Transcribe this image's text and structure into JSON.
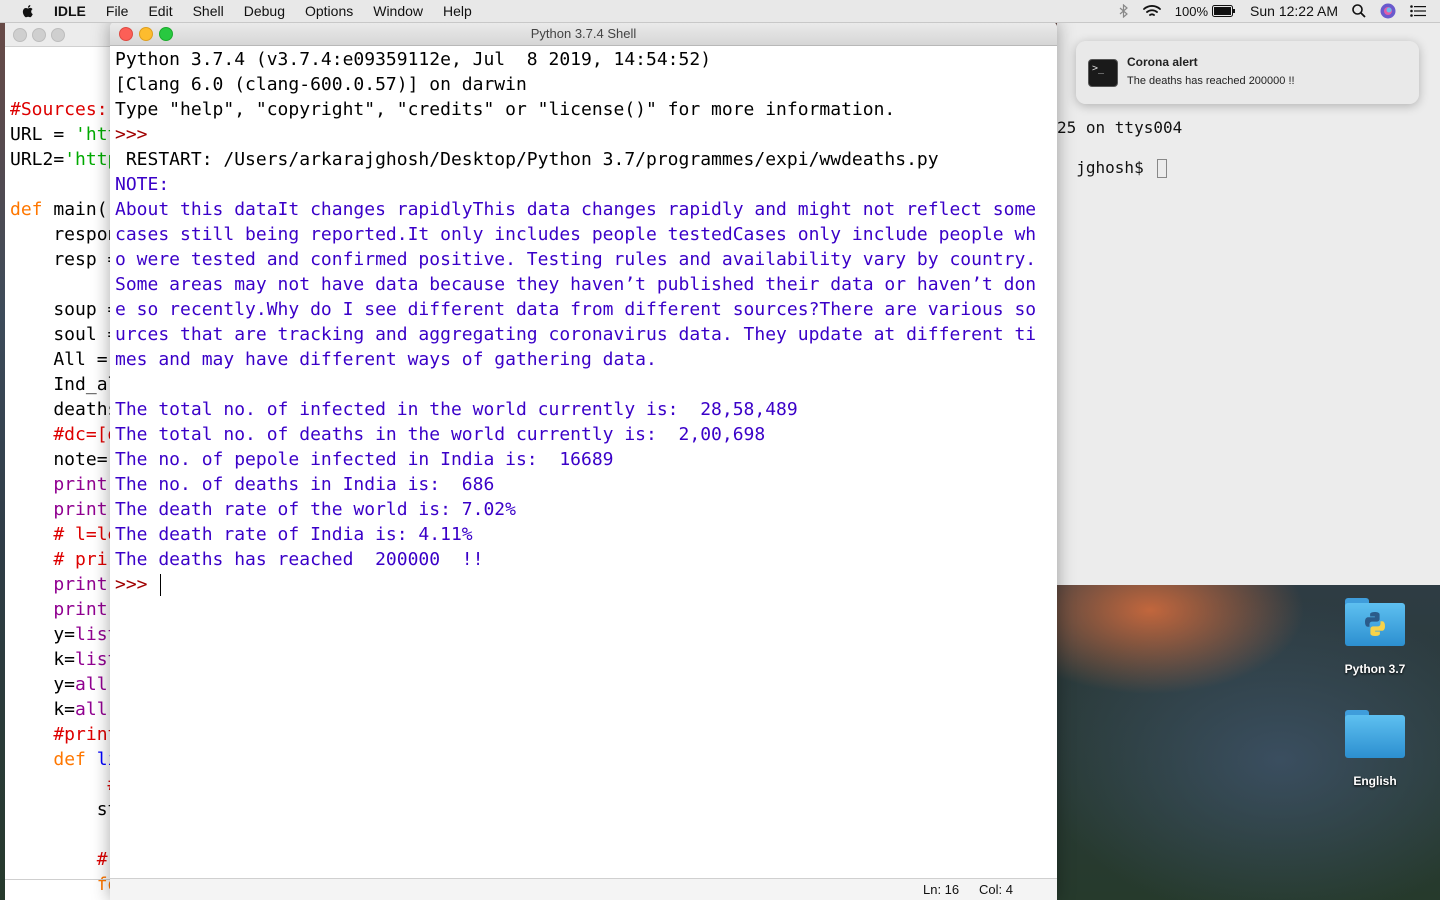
{
  "menubar": {
    "app_name": "IDLE",
    "items": [
      "File",
      "Edit",
      "Shell",
      "Debug",
      "Options",
      "Window",
      "Help"
    ],
    "battery": "100%",
    "clock": "Sun 12:22 AM"
  },
  "shell_window": {
    "title": "Python 3.7.4 Shell",
    "lines": [
      {
        "text": "Python 3.7.4 (v3.7.4:e09359112e, Jul  8 2019, 14:54:52)",
        "style": "normal"
      },
      {
        "text": "[Clang 6.0 (clang-600.0.57)] on darwin",
        "style": "normal"
      },
      {
        "text": "Type \"help\", \"copyright\", \"credits\" or \"license()\" for more information.",
        "style": "normal"
      },
      {
        "text": ">>> ",
        "style": "prompt"
      },
      {
        "text": " RESTART: /Users/arkarajghosh/Desktop/Python 3.7/programmes/expi/wwdeaths.py",
        "style": "normal"
      },
      {
        "text": "NOTE:",
        "style": "note"
      },
      {
        "text": "About this dataIt changes rapidlyThis data changes rapidly and might not reflect some",
        "style": "note"
      },
      {
        "text": "cases still being reported.It only includes people testedCases only include people wh",
        "style": "note"
      },
      {
        "text": "o were tested and confirmed positive. Testing rules and availability vary by country.",
        "style": "note"
      },
      {
        "text": "Some areas may not have data because they haven’t published their data or haven’t don",
        "style": "note"
      },
      {
        "text": "e so recently.Why do I see different data from different sources?There are various so",
        "style": "note"
      },
      {
        "text": "urces that are tracking and aggregating coronavirus data. They update at different ti",
        "style": "note"
      },
      {
        "text": "mes and may have different ways of gathering data.",
        "style": "note"
      },
      {
        "text": "",
        "style": "note"
      },
      {
        "text": "The total no. of infected in the world currently is:  28,58,489",
        "style": "note"
      },
      {
        "text": "The total no. of deaths in the world currently is:  2,00,698",
        "style": "note"
      },
      {
        "text": "The no. of pepole infected in India is:  16689",
        "style": "note"
      },
      {
        "text": "The no. of deaths in India is:  686",
        "style": "note"
      },
      {
        "text": "The death rate of the world is: 7.02%",
        "style": "note"
      },
      {
        "text": "The death rate of India is: 4.11%",
        "style": "note"
      },
      {
        "text": "The deaths has reached  200000  !!",
        "style": "note"
      },
      {
        "text": ">>> ",
        "style": "prompt-cursor"
      }
    ],
    "status": {
      "ln": "Ln: 16",
      "col": "Col: 4"
    }
  },
  "editor_window": {
    "lines": [
      {
        "parts": [
          {
            "t": "",
            "c": ""
          }
        ]
      },
      {
        "parts": [
          {
            "t": "#Sources:(",
            "c": "c-comment"
          }
        ]
      },
      {
        "parts": [
          {
            "t": "URL = ",
            "c": ""
          },
          {
            "t": "'htt",
            "c": "c-string"
          }
        ]
      },
      {
        "parts": [
          {
            "t": "URL2=",
            "c": ""
          },
          {
            "t": "'http",
            "c": "c-string"
          }
        ]
      },
      {
        "parts": [
          {
            "t": "",
            "c": ""
          }
        ]
      },
      {
        "parts": [
          {
            "t": "def",
            "c": "c-kw"
          },
          {
            "t": " main()",
            "c": ""
          }
        ]
      },
      {
        "parts": [
          {
            "t": "    respon",
            "c": ""
          }
        ]
      },
      {
        "parts": [
          {
            "t": "    resp =",
            "c": ""
          }
        ]
      },
      {
        "parts": [
          {
            "t": "",
            "c": ""
          }
        ]
      },
      {
        "parts": [
          {
            "t": "    soup =",
            "c": ""
          }
        ]
      },
      {
        "parts": [
          {
            "t": "    soul =",
            "c": ""
          }
        ]
      },
      {
        "parts": [
          {
            "t": "    All =",
            "c": ""
          }
        ]
      },
      {
        "parts": [
          {
            "t": "    Ind_al",
            "c": ""
          }
        ]
      },
      {
        "parts": [
          {
            "t": "    deaths",
            "c": ""
          }
        ]
      },
      {
        "parts": [
          {
            "t": "    #dc=[d",
            "c": "c-comment"
          }
        ]
      },
      {
        "parts": [
          {
            "t": "    note=",
            "c": ""
          }
        ]
      },
      {
        "parts": [
          {
            "t": "    ",
            "c": ""
          },
          {
            "t": "print",
            "c": "c-builtin"
          }
        ]
      },
      {
        "parts": [
          {
            "t": "    ",
            "c": ""
          },
          {
            "t": "print",
            "c": "c-builtin"
          }
        ]
      },
      {
        "parts": [
          {
            "t": "    # l=le",
            "c": "c-comment"
          }
        ]
      },
      {
        "parts": [
          {
            "t": "    # pri",
            "c": "c-comment"
          }
        ]
      },
      {
        "parts": [
          {
            "t": "    ",
            "c": ""
          },
          {
            "t": "print",
            "c": "c-builtin"
          }
        ]
      },
      {
        "parts": [
          {
            "t": "    ",
            "c": ""
          },
          {
            "t": "print",
            "c": "c-builtin"
          }
        ]
      },
      {
        "parts": [
          {
            "t": "    y=",
            "c": ""
          },
          {
            "t": "list",
            "c": "c-builtin"
          }
        ]
      },
      {
        "parts": [
          {
            "t": "    k=",
            "c": ""
          },
          {
            "t": "list",
            "c": "c-builtin"
          }
        ]
      },
      {
        "parts": [
          {
            "t": "    y=",
            "c": ""
          },
          {
            "t": "all",
            "c": "c-builtin"
          }
        ]
      },
      {
        "parts": [
          {
            "t": "    k=",
            "c": ""
          },
          {
            "t": "all",
            "c": "c-builtin"
          }
        ]
      },
      {
        "parts": [
          {
            "t": "    #print",
            "c": "c-comment"
          }
        ]
      },
      {
        "parts": [
          {
            "t": "    ",
            "c": ""
          },
          {
            "t": "def",
            "c": "c-kw"
          },
          {
            "t": " li",
            "c": "c-def"
          }
        ]
      },
      {
        "parts": [
          {
            "t": "         #",
            "c": "c-comment"
          }
        ]
      },
      {
        "parts": [
          {
            "t": "        st",
            "c": ""
          }
        ]
      },
      {
        "parts": [
          {
            "t": "",
            "c": ""
          }
        ]
      },
      {
        "parts": [
          {
            "t": "        #",
            "c": "c-comment"
          }
        ]
      },
      {
        "parts": [
          {
            "t": "        ",
            "c": ""
          },
          {
            "t": "fo",
            "c": "c-kw"
          }
        ]
      }
    ]
  },
  "terminal": {
    "line1": "25 on ttys004",
    "line2": "jghosh$ "
  },
  "notification": {
    "title": "Corona alert",
    "body": "The deaths has reached 200000 !!"
  },
  "desktop_icons": [
    {
      "label": "Python 3.7",
      "icon": "python-folder-icon"
    },
    {
      "label": "English",
      "icon": "folder-icon"
    }
  ],
  "colors": {
    "prompt": "#a00000",
    "program_output": "#3a00c8",
    "close": "#fc5f57",
    "minimize": "#fdbc2e",
    "zoom": "#28c840"
  }
}
